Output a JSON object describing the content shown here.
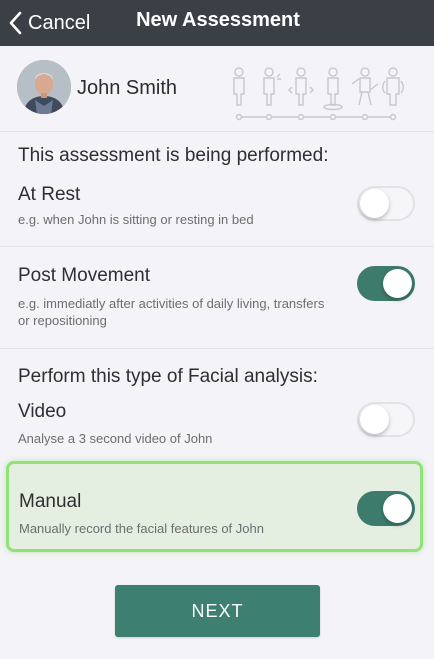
{
  "navbar": {
    "back_label": "Cancel",
    "title": "New Assessment"
  },
  "patient": {
    "name": "John Smith"
  },
  "conditions_section": {
    "title": "This assessment is being performed:",
    "options": [
      {
        "label": "At Rest",
        "description": "e.g. when John is sitting or resting in bed",
        "enabled": false
      },
      {
        "label": "Post Movement",
        "description_line1": "e.g. immediatly after activities of daily living, transfers",
        "description_line2": "or repositioning",
        "enabled": true
      }
    ]
  },
  "analysis_section": {
    "title": "Perform this type of Facial analysis:",
    "options": [
      {
        "label": "Video",
        "description": "Analyse a 3 second video of John",
        "enabled": false
      },
      {
        "label": "Manual",
        "description": "Manually record the facial features of John",
        "enabled": true,
        "highlighted": true
      }
    ]
  },
  "next_button": {
    "label": "NEXT"
  },
  "colors": {
    "navbar": "#3b4046",
    "accent": "#3d7f70",
    "highlight_border": "#92e27a",
    "background": "#f4f3f7"
  }
}
